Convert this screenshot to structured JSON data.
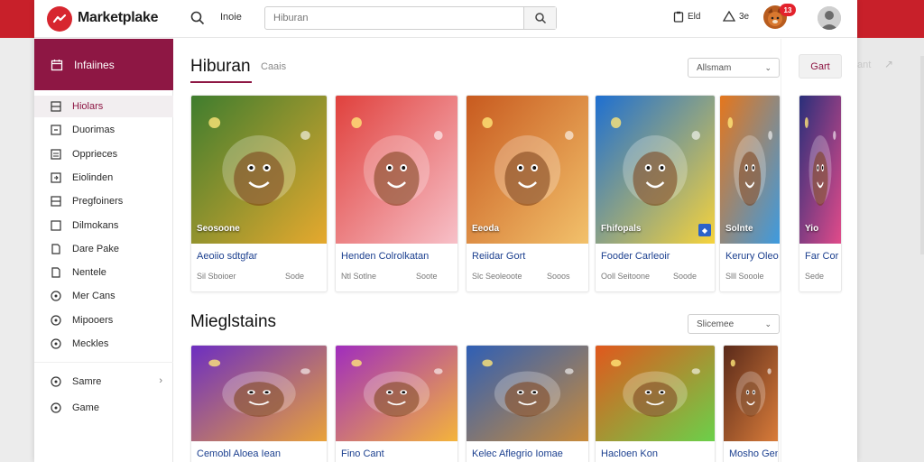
{
  "header": {
    "logo_text": "Marketplake",
    "home_label": "Inoie",
    "search_placeholder": "Hiburan",
    "item1": "Eld",
    "item2": "3e",
    "notif_count": "13"
  },
  "sidebar": {
    "head_label": "Infaiines",
    "items": [
      {
        "label": "Hiolars",
        "icon": "grid-icon",
        "active": true
      },
      {
        "label": "Duorimas",
        "icon": "box-icon"
      },
      {
        "label": "Opprieces",
        "icon": "list-icon"
      },
      {
        "label": "Eiolinden",
        "icon": "arrow-box-icon"
      },
      {
        "label": "Pregfoiners",
        "icon": "grid-icon"
      },
      {
        "label": "Dilmokans",
        "icon": "square-icon"
      },
      {
        "label": "Dare Pake",
        "icon": "doc-icon"
      },
      {
        "label": "Nentele",
        "icon": "doc-icon"
      },
      {
        "label": "Mer Cans",
        "icon": "circle-icon"
      },
      {
        "label": "Mipooers",
        "icon": "circle-icon"
      },
      {
        "label": "Meckles",
        "icon": "circle-icon"
      }
    ],
    "bottom_items": [
      {
        "label": "Samre",
        "icon": "circle-icon",
        "chevron": "›"
      },
      {
        "label": "Game",
        "icon": "circle-icon"
      }
    ]
  },
  "section1": {
    "title": "Hiburan",
    "tab": "Caais",
    "sort_label": "Allsmam",
    "cards": [
      {
        "thumb_label": "Seosoone",
        "title": "Aeoiio sdtgfar",
        "meta": "Sil Sboioer",
        "meta2": "Sode",
        "colors": [
          "#3f7d2e",
          "#e6a92e"
        ]
      },
      {
        "thumb_label": "",
        "title": "Henden Colrolkatan",
        "meta": "Ntl Sotlne",
        "meta2": "Soote",
        "colors": [
          "#e0413d",
          "#f7c0c8"
        ]
      },
      {
        "thumb_label": "Eeoda",
        "title": "Reiidar Gort",
        "meta": "Slc Seoleoote",
        "meta2": "Sooos",
        "colors": [
          "#c85a1f",
          "#f2c16b"
        ]
      },
      {
        "thumb_label": "Fhifopals",
        "title": "Fooder Carleoir",
        "meta": "Ooll Seitoone",
        "meta2": "Soode",
        "colors": [
          "#1e6fd1",
          "#f6d33c"
        ]
      },
      {
        "thumb_label": "Solnte",
        "title": "Kerury Oleo",
        "meta": "Slll Sooole",
        "meta2": "",
        "colors": [
          "#e5761c",
          "#3d9be0"
        ]
      },
      {
        "thumb_label": "Yio",
        "title": "Far Cor",
        "meta": "Sede",
        "meta2": "",
        "colors": [
          "#2a2f7a",
          "#e14b8a"
        ]
      }
    ]
  },
  "section2": {
    "title": "Mieglstains",
    "sort_label": "Slicemee",
    "cards": [
      {
        "title": "Cemobl Aloea Iean",
        "colors": [
          "#6d2ec1",
          "#e9a23a"
        ]
      },
      {
        "title": "Fino Cant",
        "colors": [
          "#a02dbd",
          "#f4b43b"
        ]
      },
      {
        "title": "Kelec Aflegrio Iomae",
        "colors": [
          "#2f5fb5",
          "#c98b3a"
        ]
      },
      {
        "title": "Hacloen Kon",
        "colors": [
          "#e0581d",
          "#6bd04a"
        ]
      },
      {
        "title": "Mosho Gene",
        "colors": [
          "#5a2a1a",
          "#d97c3a"
        ]
      }
    ]
  },
  "right_gutter": {
    "ghost_text": "ant",
    "ghost_arrow": "↗"
  },
  "cart_button": "Gart",
  "colors": {
    "accent": "#8e1744",
    "brand_red": "#c8202a",
    "link": "#1b3f8f"
  }
}
